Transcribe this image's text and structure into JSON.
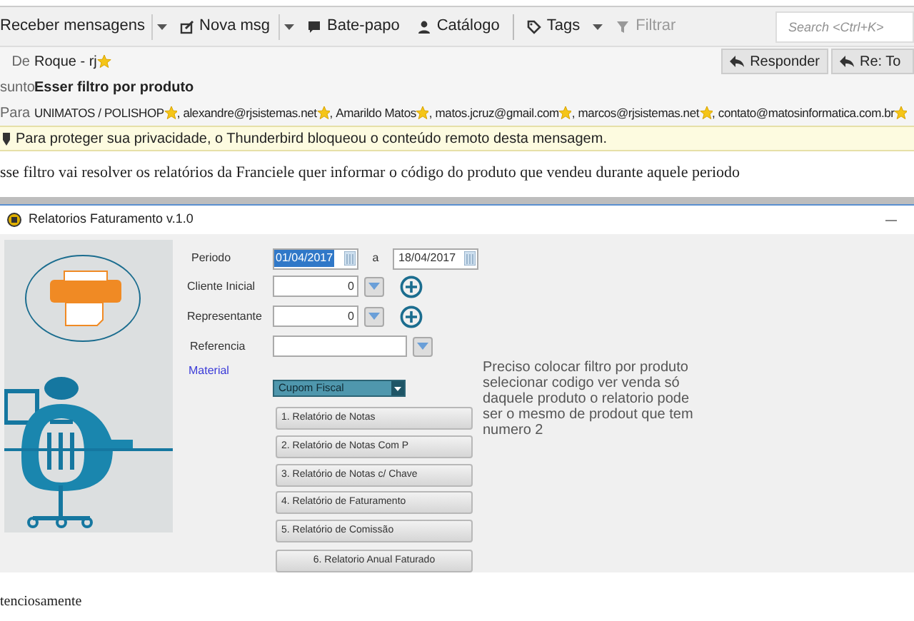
{
  "toolbar": {
    "items": [
      {
        "label": "Receber mensagens",
        "has_menu": true,
        "disabled": false
      },
      {
        "label": "Nova msg",
        "has_menu": true,
        "disabled": false
      },
      {
        "label": "Bate-papo",
        "has_menu": false,
        "disabled": false
      },
      {
        "label": "Catálogo",
        "has_menu": false,
        "disabled": false
      },
      {
        "label": "Tags",
        "has_menu": true,
        "disabled": false
      },
      {
        "label": "Filtrar",
        "has_menu": false,
        "disabled": true
      }
    ],
    "search": {
      "placeholder": "Search <Ctrl+K>"
    }
  },
  "header": {
    "from_label": "De",
    "from": "Roque - rj",
    "subject_label": "sunto",
    "subject": "Esser filtro por produto",
    "to_label": "Para",
    "recipients": [
      "UNIMATOS / POLISHOP",
      "alexandre@rjsistemas.net",
      "Amarildo Matos",
      "matos.jcruz@gmail.com",
      "marcos@rjsistemas.net",
      "contato@matosinformatica.com.br"
    ],
    "separator": ",",
    "buttons": [
      "Responder",
      "Re: To"
    ]
  },
  "notice": "Para proteger sua privacidade, o Thunderbird bloqueou o conteúdo remoto desta mensagem.",
  "body": "sse filtro vai resolver os relatórios da Franciele quer informar o código do produto que vendeu durante aquele periodo",
  "app": {
    "title": "Relatorios Faturamento v.1.0",
    "period": {
      "label": "Periodo",
      "from": "01/04/2017",
      "separator": "a",
      "to": "18/04/2017"
    },
    "fields": [
      {
        "label": "Cliente Inicial",
        "value": "0",
        "kind": "numeric",
        "add": true
      },
      {
        "label": "Representante",
        "value": "0",
        "kind": "numeric",
        "add": true
      },
      {
        "label": "Referencia",
        "kind": "text",
        "add": false
      }
    ],
    "material": {
      "label": "Material",
      "value": "Cupom Fiscal"
    },
    "reports": [
      "1. Relatório de Notas",
      "2. Relatório de Notas Com P",
      "3. Relatório de Notas c/ Chave",
      "4. Relatório de Faturamento",
      "5. Relatório de Comissão",
      "6. Relatorio Anual Faturado"
    ],
    "note": "Preciso colocar filtro por produto selecionar codigo ver venda só daquele produto o relatorio pode ser o mesmo de prodout que tem numero 2"
  },
  "closing": "tenciosamente"
}
